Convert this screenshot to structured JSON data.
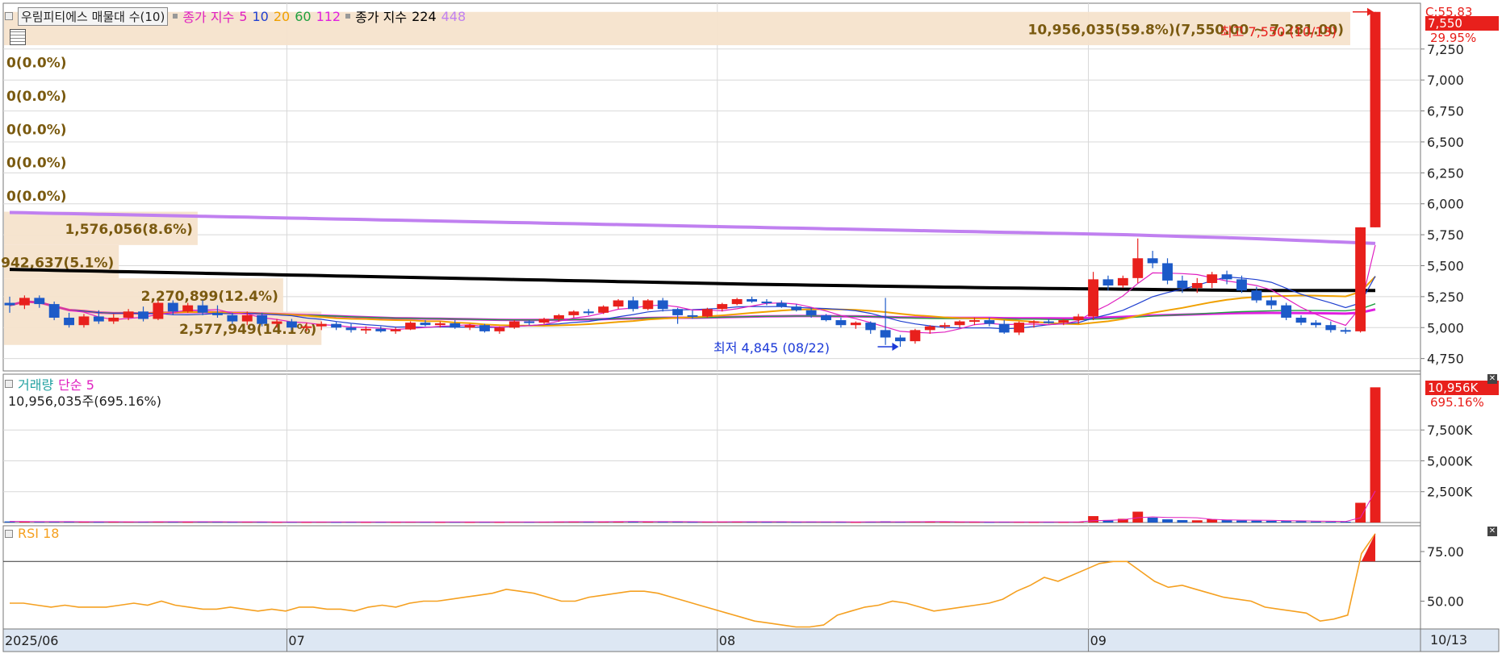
{
  "legend": {
    "title": "우림피티에스 매물대 수(10)",
    "ma_label": "종가 지수",
    "ma_short": [
      {
        "label": "5",
        "color": "#e020c0"
      },
      {
        "label": "10",
        "color": "#2040d0"
      },
      {
        "label": "20",
        "color": "#f0a000"
      },
      {
        "label": "60",
        "color": "#20a040"
      },
      {
        "label": "112",
        "color": "#e020e0"
      }
    ],
    "ma_long_label": "종가 지수",
    "ma_long": [
      {
        "label": "224",
        "color": "#000000"
      },
      {
        "label": "448",
        "color": "#c080f0"
      }
    ]
  },
  "right_top": {
    "c_label": "C:55.83",
    "last_price": "7,550",
    "change_pct": "29.95%"
  },
  "annotations": {
    "high": "최고 7,550 (10/13)",
    "low": "최저 4,845 (08/22)"
  },
  "volume_profile": [
    {
      "label": "10,956,035(59.8%)(7,550.00 ~ 7,281.00)",
      "low": 7281,
      "high": 7550,
      "pct": 59.8
    },
    {
      "label": "0(0.0%)",
      "low": 7012,
      "high": 7281,
      "pct": 0
    },
    {
      "label": "0(0.0%)",
      "low": 6743,
      "high": 7012,
      "pct": 0
    },
    {
      "label": "0(0.0%)",
      "low": 6474,
      "high": 6743,
      "pct": 0
    },
    {
      "label": "0(0.0%)",
      "low": 6205,
      "high": 6474,
      "pct": 0
    },
    {
      "label": "0(0.0%)",
      "low": 5936,
      "high": 6205,
      "pct": 0
    },
    {
      "label": "1,576,056(8.6%)",
      "low": 5667,
      "high": 5936,
      "pct": 8.6
    },
    {
      "label": "942,637(5.1%)",
      "low": 5398,
      "high": 5667,
      "pct": 5.1
    },
    {
      "label": "2,270,899(12.4%)",
      "low": 5129,
      "high": 5398,
      "pct": 12.4
    },
    {
      "label": "2,577,949(14.1%)",
      "low": 4860,
      "high": 5129,
      "pct": 14.1
    }
  ],
  "volume_panel": {
    "title": "거래량",
    "ma_label": "단순 5",
    "info": "10,956,035주(695.16%)",
    "badge": "10,956K",
    "badge_pct": "695.16%"
  },
  "rsi_panel": {
    "title": "RSI 18"
  },
  "colors": {
    "up": "#e8201c",
    "down": "#1c5ac8",
    "grid": "#d8d8d8",
    "profile": "#f5e3cc",
    "profile_text": "#7a5a10",
    "ma224": "#000000",
    "ma448": "#c080f0",
    "rsi": "#f5a020",
    "accent": "#e8201c"
  },
  "chart_data": [
    {
      "type": "candlestick",
      "name": "price",
      "ylim": [
        4650,
        7620
      ],
      "yticks": [
        "7,250",
        "7,000",
        "6,750",
        "6,500",
        "6,250",
        "6,000",
        "5,750",
        "5,500",
        "5,250",
        "5,000",
        "4,750"
      ],
      "ytick_values": [
        7250,
        7000,
        6750,
        6500,
        6250,
        6000,
        5750,
        5500,
        5250,
        5000,
        4750
      ],
      "x_labels": [
        {
          "label": "2025/06",
          "index": 0
        },
        {
          "label": "07",
          "index": 19
        },
        {
          "label": "08",
          "index": 48
        },
        {
          "label": "09",
          "index": 73
        },
        {
          "label": "10",
          "index": 101
        }
      ],
      "date_end_label": "10/13",
      "ohlc": [
        [
          5200,
          5250,
          5120,
          5180
        ],
        [
          5180,
          5260,
          5150,
          5240
        ],
        [
          5240,
          5260,
          5160,
          5190
        ],
        [
          5190,
          5210,
          5060,
          5080
        ],
        [
          5080,
          5120,
          5000,
          5020
        ],
        [
          5020,
          5110,
          5000,
          5090
        ],
        [
          5090,
          5140,
          5030,
          5050
        ],
        [
          5050,
          5110,
          5030,
          5080
        ],
        [
          5080,
          5150,
          5060,
          5130
        ],
        [
          5130,
          5170,
          5050,
          5070
        ],
        [
          5070,
          5220,
          5060,
          5200
        ],
        [
          5200,
          5220,
          5100,
          5130
        ],
        [
          5130,
          5200,
          5120,
          5180
        ],
        [
          5180,
          5220,
          5100,
          5120
        ],
        [
          5120,
          5180,
          5080,
          5100
        ],
        [
          5100,
          5120,
          5030,
          5050
        ],
        [
          5050,
          5130,
          5020,
          5100
        ],
        [
          5100,
          5120,
          5010,
          5030
        ],
        [
          5030,
          5070,
          5000,
          5050
        ],
        [
          5050,
          5070,
          4980,
          5000
        ],
        [
          5000,
          5040,
          4970,
          5010
        ],
        [
          5010,
          5050,
          4980,
          5030
        ],
        [
          5030,
          5050,
          4980,
          5000
        ],
        [
          5000,
          5030,
          4960,
          4980
        ],
        [
          4980,
          5010,
          4950,
          4990
        ],
        [
          4990,
          5010,
          4960,
          4970
        ],
        [
          4970,
          5000,
          4950,
          4985
        ],
        [
          4985,
          5050,
          4980,
          5040
        ],
        [
          5040,
          5060,
          5010,
          5020
        ],
        [
          5020,
          5050,
          5000,
          5035
        ],
        [
          5035,
          5060,
          4990,
          5000
        ],
        [
          5000,
          5030,
          4980,
          5020
        ],
        [
          5020,
          5030,
          4960,
          4970
        ],
        [
          4970,
          5010,
          4950,
          5000
        ],
        [
          5000,
          5060,
          4990,
          5050
        ],
        [
          5050,
          5060,
          5020,
          5040
        ],
        [
          5040,
          5080,
          5030,
          5070
        ],
        [
          5070,
          5110,
          5050,
          5100
        ],
        [
          5100,
          5140,
          5080,
          5130
        ],
        [
          5130,
          5150,
          5100,
          5120
        ],
        [
          5120,
          5180,
          5110,
          5170
        ],
        [
          5170,
          5230,
          5150,
          5220
        ],
        [
          5220,
          5250,
          5130,
          5150
        ],
        [
          5150,
          5230,
          5140,
          5220
        ],
        [
          5220,
          5240,
          5130,
          5150
        ],
        [
          5150,
          5160,
          5030,
          5100
        ],
        [
          5100,
          5140,
          5070,
          5090
        ],
        [
          5090,
          5160,
          5080,
          5150
        ],
        [
          5150,
          5200,
          5130,
          5190
        ],
        [
          5190,
          5240,
          5180,
          5230
        ],
        [
          5230,
          5250,
          5200,
          5210
        ],
        [
          5210,
          5230,
          5180,
          5200
        ],
        [
          5200,
          5220,
          5160,
          5170
        ],
        [
          5170,
          5190,
          5130,
          5140
        ],
        [
          5140,
          5160,
          5080,
          5100
        ],
        [
          5100,
          5110,
          5050,
          5060
        ],
        [
          5060,
          5080,
          5000,
          5020
        ],
        [
          5020,
          5050,
          4990,
          5040
        ],
        [
          5040,
          5050,
          4950,
          4980
        ],
        [
          4980,
          5240,
          4860,
          4920
        ],
        [
          4920,
          4940,
          4845,
          4890
        ],
        [
          4890,
          4990,
          4870,
          4980
        ],
        [
          4980,
          5020,
          4950,
          5010
        ],
        [
          5010,
          5040,
          4990,
          5020
        ],
        [
          5020,
          5060,
          5000,
          5050
        ],
        [
          5050,
          5080,
          5020,
          5060
        ],
        [
          5060,
          5080,
          5010,
          5030
        ],
        [
          5030,
          5060,
          4950,
          4960
        ],
        [
          4960,
          5050,
          4940,
          5040
        ],
        [
          5040,
          5060,
          5000,
          5050
        ],
        [
          5050,
          5070,
          5030,
          5040
        ],
        [
          5040,
          5070,
          5020,
          5060
        ],
        [
          5060,
          5110,
          5030,
          5090
        ],
        [
          5090,
          5450,
          5060,
          5390
        ],
        [
          5390,
          5420,
          5300,
          5340
        ],
        [
          5340,
          5420,
          5320,
          5400
        ],
        [
          5400,
          5720,
          5360,
          5560
        ],
        [
          5560,
          5620,
          5480,
          5520
        ],
        [
          5520,
          5560,
          5350,
          5380
        ],
        [
          5380,
          5420,
          5280,
          5320
        ],
        [
          5320,
          5400,
          5280,
          5360
        ],
        [
          5360,
          5450,
          5320,
          5430
        ],
        [
          5430,
          5460,
          5350,
          5390
        ],
        [
          5390,
          5420,
          5280,
          5300
        ],
        [
          5300,
          5330,
          5200,
          5220
        ],
        [
          5220,
          5250,
          5150,
          5180
        ],
        [
          5180,
          5200,
          5060,
          5080
        ],
        [
          5080,
          5100,
          5020,
          5040
        ],
        [
          5040,
          5060,
          5000,
          5020
        ],
        [
          5020,
          5050,
          4960,
          4980
        ],
        [
          4980,
          5000,
          4950,
          4970
        ],
        [
          4970,
          5810,
          4960,
          5810
        ],
        [
          5810,
          7550,
          5810,
          7550
        ]
      ],
      "ma224": [
        5470,
        5450,
        5430,
        5410,
        5390,
        5370,
        5350,
        5335,
        5320,
        5310,
        5300,
        5300
      ],
      "ma448": [
        5930,
        5910,
        5890,
        5870,
        5850,
        5830,
        5810,
        5790,
        5770,
        5750,
        5720,
        5680
      ]
    },
    {
      "type": "bar",
      "name": "volume",
      "ylim": [
        0,
        11500000
      ],
      "yticks": [
        "7,500K",
        "5,000K",
        "2,500K"
      ],
      "ytick_values": [
        7500000,
        5000000,
        2500000
      ],
      "values": [
        90000,
        70000,
        60000,
        80000,
        70000,
        60000,
        50000,
        60000,
        70000,
        60000,
        80000,
        60000,
        50000,
        70000,
        60000,
        50000,
        60000,
        50000,
        40000,
        50000,
        40000,
        60000,
        40000,
        50000,
        40000,
        50000,
        40000,
        60000,
        50000,
        40000,
        50000,
        40000,
        50000,
        40000,
        60000,
        50000,
        60000,
        70000,
        80000,
        60000,
        70000,
        90000,
        80000,
        70000,
        60000,
        70000,
        50000,
        60000,
        70000,
        80000,
        60000,
        50000,
        60000,
        50000,
        70000,
        60000,
        50000,
        40000,
        60000,
        100000,
        60000,
        80000,
        60000,
        50000,
        60000,
        50000,
        40000,
        60000,
        50000,
        40000,
        50000,
        40000,
        60000,
        520000,
        200000,
        300000,
        880000,
        400000,
        260000,
        200000,
        180000,
        260000,
        190000,
        160000,
        150000,
        140000,
        120000,
        110000,
        80000,
        60000,
        70000,
        1600000,
        10956035
      ]
    },
    {
      "type": "line",
      "name": "rsi",
      "ylim": [
        36,
        88
      ],
      "yticks": [
        "75.00",
        "50.00"
      ],
      "ytick_values": [
        75,
        50
      ],
      "threshold": 70,
      "values": [
        49,
        49,
        48,
        47,
        48,
        47,
        47,
        47,
        48,
        49,
        48,
        50,
        48,
        47,
        46,
        46,
        47,
        46,
        45,
        46,
        45,
        47,
        47,
        46,
        46,
        45,
        47,
        48,
        47,
        49,
        50,
        50,
        51,
        52,
        53,
        54,
        56,
        55,
        54,
        52,
        50,
        50,
        52,
        53,
        54,
        55,
        55,
        54,
        52,
        50,
        48,
        46,
        44,
        42,
        40,
        39,
        38,
        37,
        37,
        38,
        43,
        45,
        47,
        48,
        50,
        49,
        47,
        45,
        46,
        47,
        48,
        49,
        51,
        55,
        58,
        62,
        60,
        63,
        66,
        69,
        70,
        70,
        65,
        60,
        57,
        58,
        56,
        54,
        52,
        51,
        50,
        47,
        46,
        45,
        44,
        40,
        41,
        43,
        74,
        84
      ]
    }
  ]
}
